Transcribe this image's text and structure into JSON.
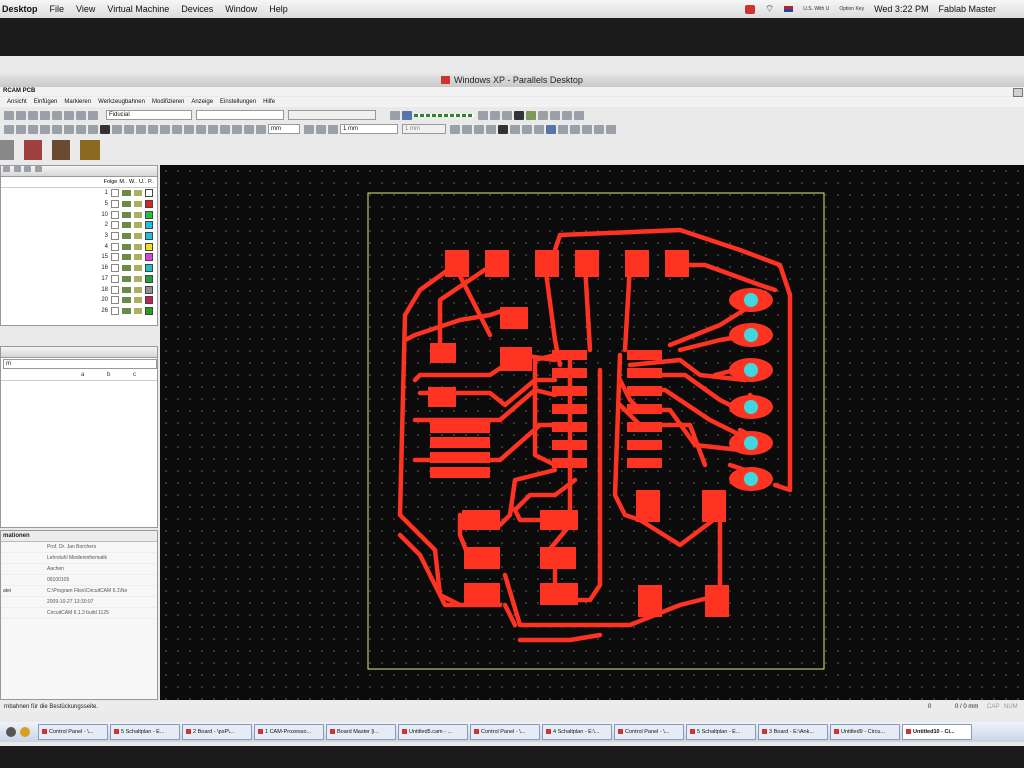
{
  "mac_menu": {
    "app_label": "Desktop",
    "items": [
      "File",
      "View",
      "Virtual Machine",
      "Devices",
      "Window",
      "Help"
    ],
    "input_label": "U.S. With U",
    "option_key": "Option Key",
    "clock": "Wed 3:22 PM",
    "user": "Fablab Master"
  },
  "window_title": "Windows XP - Parallels Desktop",
  "app": {
    "title": "RCAM PCB",
    "menu": [
      "Ansicht",
      "Einfügen",
      "Markieren",
      "Werkzeugbahnen",
      "Modifizieren",
      "Anzeige",
      "Einstellungen",
      "Hilfe"
    ]
  },
  "toolbar": {
    "fiducial_select": "Fiducial",
    "units_select": "mm",
    "grid_select": "1 mm",
    "grid_select2": "1 mm"
  },
  "layers_panel": {
    "headers": [
      "Folge",
      "M..",
      "W..",
      "U..",
      "P.."
    ],
    "rows": [
      {
        "n": "1",
        "color": "#ffffff"
      },
      {
        "n": "5",
        "color": "#e02020"
      },
      {
        "n": "10",
        "color": "#20c040"
      },
      {
        "n": "2",
        "color": "#20c0e0"
      },
      {
        "n": "3",
        "color": "#20c0e0"
      },
      {
        "n": "4",
        "color": "#f0e020"
      },
      {
        "n": "15",
        "color": "#e040e0"
      },
      {
        "n": "16",
        "color": "#20c0c0"
      },
      {
        "n": "17",
        "color": "#20a040"
      },
      {
        "n": "18",
        "color": "#909090"
      },
      {
        "n": "20",
        "color": "#c02060"
      },
      {
        "n": "26",
        "color": "#20a020"
      }
    ]
  },
  "props_panel": {
    "select": "m",
    "cols": [
      "a",
      "b",
      "c"
    ]
  },
  "info_panel": {
    "title": "mationen",
    "rows": [
      {
        "k": "",
        "v": "Prof. Dr. Jan Borchers"
      },
      {
        "k": "",
        "v": "Lehrstuhl Medieninformatik"
      },
      {
        "k": "",
        "v": "Aachen"
      },
      {
        "k": "",
        "v": "09100105"
      },
      {
        "k": "atei",
        "v": "C:\\Program Files\\CircuitCAM 6.1\\Ne"
      },
      {
        "k": "",
        "v": "2009-10-27 13:30:07"
      },
      {
        "k": "",
        "v": "CircuitCAM 6.1.3 build 1125"
      }
    ]
  },
  "status": {
    "left": "rnbahnen für die Bestückungsseite.",
    "zero": "0",
    "coords": "0 / 0 mm",
    "cap": "CAP",
    "num": "NUM",
    "scrl": "SCRL"
  },
  "taskbar": [
    "Control Panel - \\...",
    "5 Schaltplan - E...",
    "2 Board - \\psP\\...",
    "1 CAM-Prozesso...",
    "Board Master [i...",
    "Untitled5.cam - ...",
    "Control Panel - \\...",
    "4 Schaltplan - E:\\...",
    "Control Panel - \\...",
    "5 Schaltplan - E...",
    "3 Board - E:\\Ank...",
    "Untitled9 - Circu...",
    "Untitled10 - Ci..."
  ],
  "colors": {
    "copper": "#ff3322",
    "pad_hole": "#40d8e0",
    "outline": "#e6e87a",
    "canvas_bg": "#0b0b0b"
  }
}
